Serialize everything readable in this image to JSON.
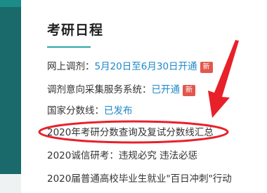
{
  "panel": {
    "title": "考研日程"
  },
  "items": [
    {
      "label": "网上调剂：",
      "value": "5月20日至6月30日开通",
      "badge": "新"
    },
    {
      "label": "调剂意向采集服务系统：",
      "value": "已开通",
      "badge": "新"
    },
    {
      "label": "国家分数线：",
      "value": "已发布"
    },
    {
      "label": "2020年考研分数查询及复试分数线汇总"
    },
    {
      "label": "2020诚信研考：违规必究 违法必惩"
    },
    {
      "label": "2020届普通高校毕业生就业\"百日冲刺\"行动"
    }
  ],
  "annotation": {
    "color": "#e8202a"
  }
}
